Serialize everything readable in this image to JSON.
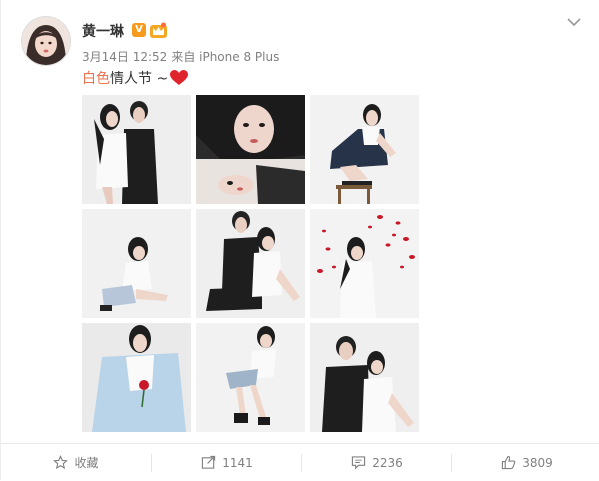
{
  "post": {
    "username": "黄一琳",
    "verified_badge": "V",
    "date": "3月14日 12:52",
    "source": "来自 iPhone 8 Plus",
    "text_tag": "白色",
    "text_body": "情人节 ~",
    "heart_icon": "red-heart-emoji"
  },
  "actions": {
    "favorite_label": "收藏",
    "repost_count": "1141",
    "comment_count": "2236",
    "like_count": "3809"
  },
  "colors": {
    "accent_orange": "#eb7350",
    "badge_gold": "#f79b1f",
    "heart_red": "#e0242c",
    "text_gray": "#808080"
  }
}
